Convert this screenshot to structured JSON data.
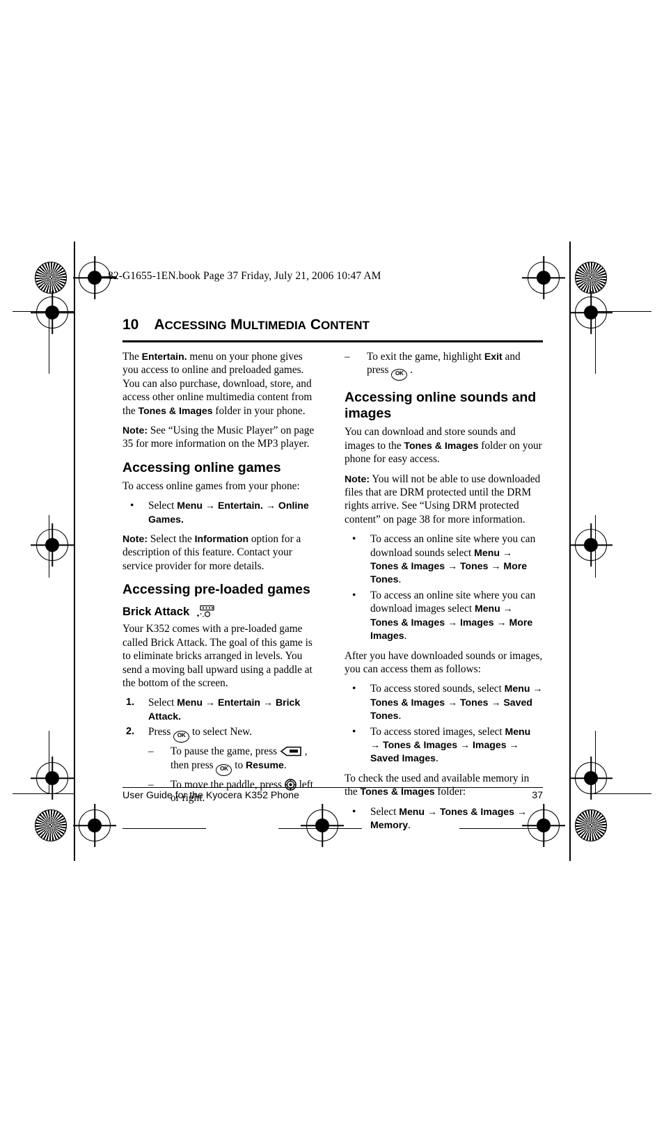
{
  "print_marks": {
    "present": true
  },
  "book_header": "82-G1655-1EN.book  Page 37  Friday, July 21, 2006  10:47 AM",
  "chapter": {
    "number": "10",
    "title_first": "A",
    "title_rest_1": "CCESSING",
    "title_first_2": "M",
    "title_rest_2": "ULTIMEDIA",
    "title_first_3": "C",
    "title_rest_3": "ONTENT",
    "title_plain": "10 ACCESSING MULTIMEDIA CONTENT"
  },
  "left_column": {
    "intro_p1_a": "The ",
    "intro_p1_b": "Entertain.",
    "intro_p1_c": " menu on your phone gives you access to online and preloaded games. You can also purchase, download, store, and access other online multimedia content from the ",
    "intro_p1_d": "Tones & Images",
    "intro_p1_e": " folder in your phone.",
    "note1_label": "Note:",
    "note1_text": "  See “Using the Music Player” on page 35 for more information on the MP3 player.",
    "h_online_games": "Accessing online games",
    "online_games_lead": "To access online games from your phone:",
    "bullet_select_a": "Select ",
    "bullet_select_menu": "Menu",
    "bullet_select_arrow1": " → ",
    "bullet_select_entertain": "Entertain.",
    "bullet_select_arrow2": " → ",
    "bullet_select_online": "Online Games.",
    "note2_label": "Note:",
    "note2_a": "  Select the ",
    "note2_b": "Information",
    "note2_c": " option for a description of this feature. Contact your service provider for more details.",
    "h_preloaded": "Accessing pre-loaded games",
    "h_brick_attack": "Brick Attack",
    "brick_icon": "brick-attack-icon",
    "brick_body": "Your K352 comes with a pre-loaded game called Brick Attack. The goal of this game is to eliminate bricks arranged in levels. You send a moving ball upward using a paddle at the bottom of the screen.",
    "step1_num": "1.",
    "step1_a": "Select ",
    "step1_menu": "Menu",
    "step1_arrow1": " → ",
    "step1_entertain": "Entertain",
    "step1_arrow2": " → ",
    "step1_brick": "Brick Attack.",
    "step2_num": "2.",
    "step2_a": "Press ",
    "step2_key": "ok-key-icon",
    "step2_b": " to select New.",
    "dash1_mark": "–",
    "dash1_a": "To pause the game, press ",
    "dash1_key": "softkey-icon",
    "dash1_b": " , then press ",
    "dash1_key2": "ok-key-icon",
    "dash1_c": " to ",
    "dash1_resume": "Resume",
    "dash1_d": ".",
    "dash2_mark": "–",
    "dash2_a": "To move the paddle, press ",
    "dash2_key": "navigation-key-icon",
    "dash2_b": " left or right."
  },
  "right_column": {
    "dash_exit_mark": "–",
    "dash_exit_a": "To exit the game, highlight ",
    "dash_exit_b": "Exit",
    "dash_exit_c": " and press ",
    "dash_exit_key": "ok-key-icon",
    "dash_exit_d": " .",
    "h_sounds_images": "Accessing online sounds and images",
    "p_download_a": "You can download and store sounds and images to the ",
    "p_download_b": "Tones & Images",
    "p_download_c": " folder on your phone for easy access.",
    "note_drm_label": "Note:",
    "note_drm_text": "  You will not be able to use downloaded files that are DRM protected until the DRM rights arrive. See “Using DRM protected content” on page 38 for more information.",
    "b1_a": "To access an online site where you can download sounds select ",
    "b1_menu": "Menu",
    "b1_arrow1": " → ",
    "b1_tones_images": "Tones & Images",
    "b1_arrow2": " → ",
    "b1_tones": "Tones",
    "b1_arrow3": " → ",
    "b1_more": "More Tones",
    "b1_end": ".",
    "b2_a": "To access an online site where you can download images select ",
    "b2_menu": "Menu",
    "b2_arrow1": " → ",
    "b2_tones_images": "Tones & Images",
    "b2_arrow2": " → ",
    "b2_images": "Images",
    "b2_arrow3": " → ",
    "b2_more": "More Images",
    "b2_end": ".",
    "p_after": "After you have downloaded sounds or images, you can access them as follows:",
    "b3_a": "To access stored sounds, select ",
    "b3_menu": "Menu",
    "b3_arrow1": " → ",
    "b3_tones_images": "Tones & Images",
    "b3_arrow2": " → ",
    "b3_tones": "Tones",
    "b3_arrow3": " → ",
    "b3_saved": "Saved Tones",
    "b3_end": ".",
    "b4_a": "To access stored images, select ",
    "b4_menu": "Menu",
    "b4_arrow1": " → ",
    "b4_tones_images": "Tones & Images",
    "b4_arrow2": " → ",
    "b4_images": "Images",
    "b4_arrow3": " → ",
    "b4_saved": "Saved Images",
    "b4_end": ".",
    "p_memory_a": "To check the used and available memory in the ",
    "p_memory_b": "Tones & Images",
    "p_memory_c": " folder:",
    "b5_a": "Select ",
    "b5_menu": "Menu",
    "b5_arrow1": " → ",
    "b5_tones_images": "Tones & Images",
    "b5_arrow2": " → ",
    "b5_memory": "Memory",
    "b5_end": "."
  },
  "bullet_mark": "•",
  "footer": {
    "left": "User Guide for the Kyocera K352 Phone",
    "page_number": "37"
  }
}
